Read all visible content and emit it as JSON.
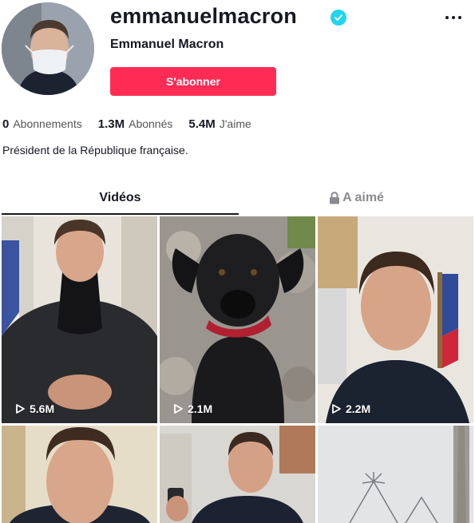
{
  "profile": {
    "username": "emmanuelmacron",
    "display_name": "Emmanuel Macron",
    "follow_label": "S'abonner",
    "bio": "Président de la République française."
  },
  "stats": [
    {
      "value": "0",
      "label": "Abonnements"
    },
    {
      "value": "1.3M",
      "label": "Abonnés"
    },
    {
      "value": "5.4M",
      "label": "J'aime"
    }
  ],
  "tabs": {
    "videos": "Vidéos",
    "liked": "A aimé"
  },
  "videos": [
    {
      "views": "5.6M"
    },
    {
      "views": "2.1M"
    },
    {
      "views": "2.2M"
    }
  ],
  "colors": {
    "accent": "#fe2c55",
    "verified": "#20d5ec"
  }
}
